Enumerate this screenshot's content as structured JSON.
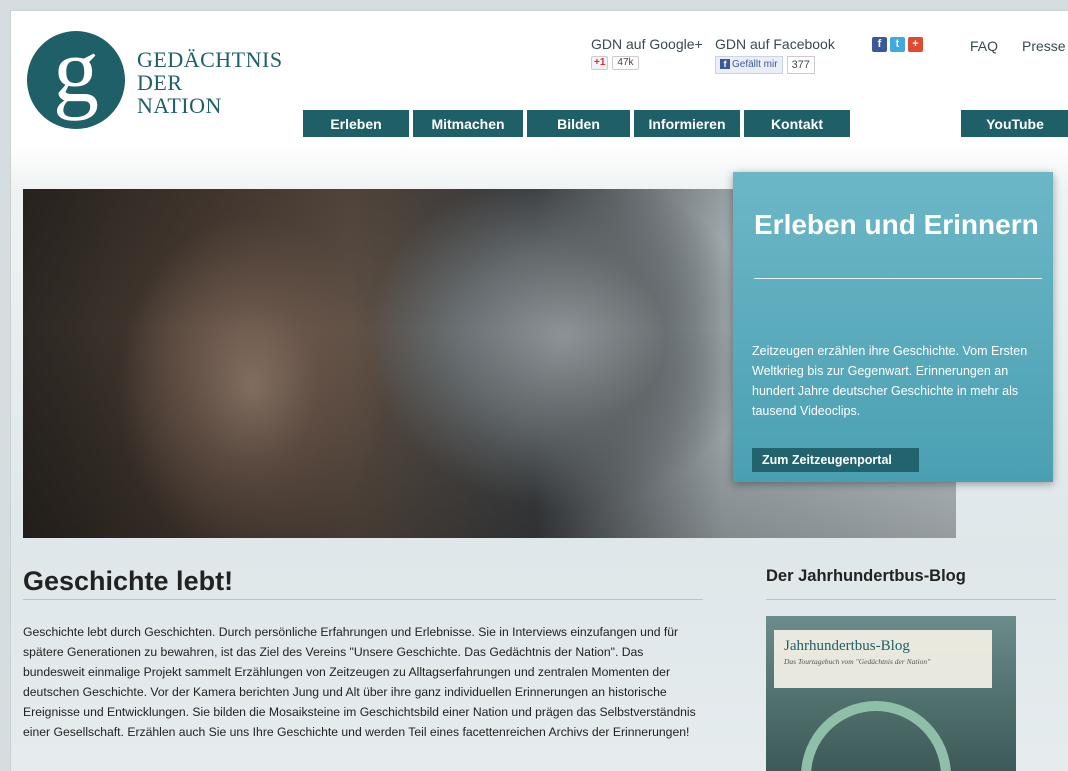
{
  "logo": {
    "letter": "g",
    "line1": "GEDÄCHTNIS",
    "line2": "DER",
    "line3": "NATION"
  },
  "social": {
    "google_label": "GDN auf Google+",
    "google_button": "+1",
    "google_count": "47k",
    "facebook_label": "GDN auf Facebook",
    "facebook_like": "Gefällt mir",
    "facebook_count": "377"
  },
  "top_links": {
    "faq": "FAQ",
    "presse": "Presse"
  },
  "icons": [
    "facebook-icon",
    "twitter-icon",
    "google-plus-icon"
  ],
  "nav": {
    "erleben": "Erleben",
    "mitmachen": "Mitmachen",
    "bilden": "Bilden",
    "informieren": "Informieren",
    "kontakt": "Kontakt",
    "youtube": "YouTube"
  },
  "teaser": {
    "title": "Erleben und Erinnern",
    "text": "Zeitzeugen erzählen ihre Geschichte. Vom Ersten Weltkrieg bis zur Gegenwart. Erinnerungen an hundert Jahre deutscher Geschichte in mehr als tausend Videoclips.",
    "button": "Zum Zeitzeugenportal"
  },
  "main": {
    "heading": "Geschichte lebt!",
    "paragraph": "Geschichte lebt durch Geschichten. Durch persönliche Erfahrungen und Erlebnisse. Sie in Interviews einzufangen und für spätere Generationen zu bewahren, ist das Ziel des Vereins \"Unsere Geschichte. Das Gedächtnis der Nation\". Das bundesweit einmalige Projekt sammelt Erzählungen von Zeitzeugen zu Alltagserfahrungen und zentralen Momenten der deutschen Geschichte. Vor der Kamera berichten Jung und Alt über ihre ganz individuellen Erinnerungen an historische Ereignisse und Entwicklungen. Sie bilden die Mosaiksteine im Geschichtsbild einer Nation und prägen das Selbstverständnis einer Gesellschaft. Erzählen auch Sie uns Ihre Geschichte und werden Teil eines facettenreichen Archivs der Erinnerungen!"
  },
  "sidebar": {
    "title": "Der Jahrhundertbus-Blog",
    "card_title": "Jahrhundertbus-Blog",
    "card_subtitle": "Das Tourtagebuch vom \"Gedächtnis der Nation\""
  },
  "colors": {
    "brand": "#1f5f68",
    "teaser": "#5aaabc"
  }
}
